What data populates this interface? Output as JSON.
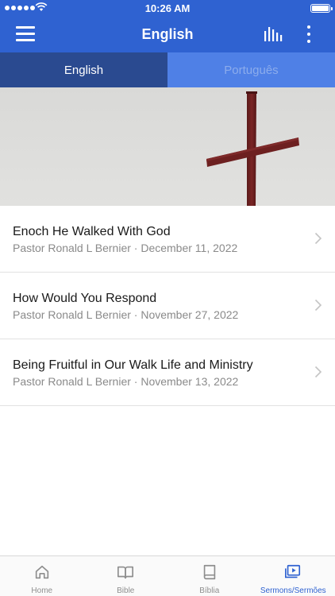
{
  "status_bar": {
    "time": "10:26 AM"
  },
  "nav": {
    "title": "English"
  },
  "tabs": [
    {
      "label": "English",
      "active": true
    },
    {
      "label": "Português",
      "active": false
    }
  ],
  "sermons": [
    {
      "title": "Enoch He Walked With God",
      "subtitle": "Pastor Ronald L Bernier · December 11, 2022"
    },
    {
      "title": "How Would You Respond",
      "subtitle": "Pastor Ronald L Bernier · November 27, 2022"
    },
    {
      "title": "Being Fruitful in Our Walk Life and Ministry",
      "subtitle": "Pastor Ronald L Bernier · November 13, 2022"
    }
  ],
  "tab_bar": [
    {
      "label": "Home",
      "icon": "home-icon",
      "active": false
    },
    {
      "label": "Bible",
      "icon": "book-open-icon",
      "active": false
    },
    {
      "label": "Bíblia",
      "icon": "book-closed-icon",
      "active": false
    },
    {
      "label": "Sermons/Sermões",
      "icon": "video-playlist-icon",
      "active": true
    }
  ],
  "colors": {
    "brand_blue": "#2f62d1",
    "active_tab": "#2a4a90",
    "inactive_tab": "#4f80e6",
    "cross": "#6b1f1f"
  }
}
